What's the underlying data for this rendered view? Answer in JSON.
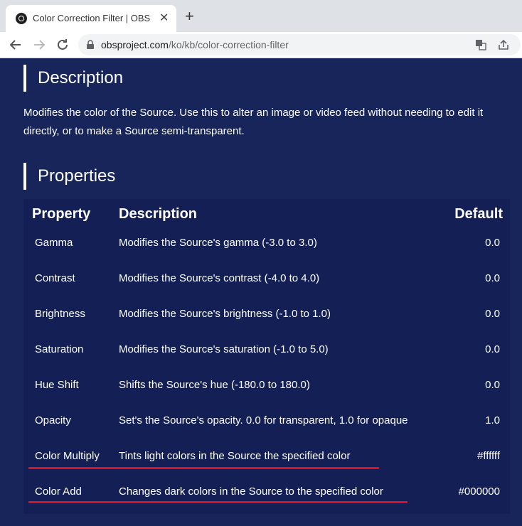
{
  "browser": {
    "tab_title": "Color Correction Filter | OBS",
    "tab_close": "✕",
    "new_tab": "+",
    "url_host": "obsproject.com",
    "url_path": "/ko/kb/color-correction-filter"
  },
  "description": {
    "heading": "Description",
    "text": "Modifies the color of the Source. Use this to alter an image or video feed without needing to edit it directly, or to make a Source semi-transparent."
  },
  "properties": {
    "heading": "Properties",
    "columns": {
      "property": "Property",
      "description": "Description",
      "default": "Default"
    },
    "rows": [
      {
        "property": "Gamma",
        "description": "Modifies the Source's gamma (-3.0 to 3.0)",
        "default": "0.0"
      },
      {
        "property": "Contrast",
        "description": "Modifies the Source's contrast (-4.0 to 4.0)",
        "default": "0.0"
      },
      {
        "property": "Brightness",
        "description": "Modifies the Source's brightness (-1.0 to 1.0)",
        "default": "0.0"
      },
      {
        "property": "Saturation",
        "description": "Modifies the Source's saturation (-1.0 to 5.0)",
        "default": "0.0"
      },
      {
        "property": "Hue Shift",
        "description": "Shifts the Source's hue (-180.0 to 180.0)",
        "default": "0.0"
      },
      {
        "property": "Opacity",
        "description": "Set's the Source's opacity. 0.0 for transparent, 1.0 for opaque",
        "default": "1.0"
      },
      {
        "property": "Color Multiply",
        "description": "Tints light colors in the Source the specified color",
        "default": "#ffffff"
      },
      {
        "property": "Color Add",
        "description": "Changes dark colors in the Source to the specified color",
        "default": "#000000"
      }
    ]
  },
  "colors": {
    "page_bg": "#17255a",
    "table_bg": "#142055",
    "annotation_underline": "#d6112a"
  }
}
